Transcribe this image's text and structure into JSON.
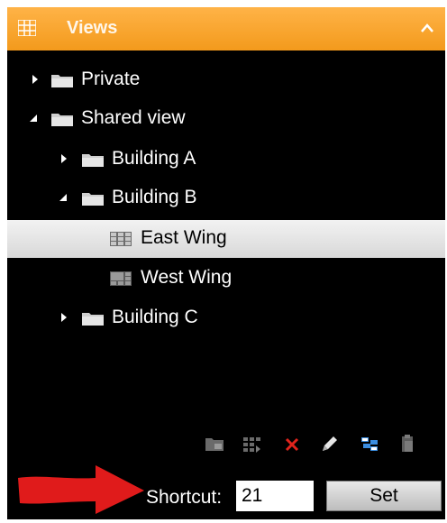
{
  "header": {
    "title": "Views",
    "icon": "grid-icon",
    "collapse_icon": "chevron-up-icon",
    "color": "#f5a623"
  },
  "tree": {
    "items": [
      {
        "label": "Private",
        "level": 0,
        "expanded": false,
        "icon": "folder-icon"
      },
      {
        "label": "Shared view",
        "level": 0,
        "expanded": true,
        "icon": "folder-icon"
      },
      {
        "label": "Building A",
        "level": 1,
        "expanded": false,
        "icon": "folder-icon"
      },
      {
        "label": "Building B",
        "level": 1,
        "expanded": true,
        "icon": "folder-icon"
      },
      {
        "label": "East Wing",
        "level": 2,
        "selected": true,
        "icon": "view-layout-icon"
      },
      {
        "label": "West Wing",
        "level": 2,
        "selected": false,
        "icon": "view-layout-icon"
      },
      {
        "label": "Building C",
        "level": 1,
        "expanded": false,
        "icon": "folder-icon"
      }
    ]
  },
  "toolbar": {
    "buttons": [
      "new-group-icon",
      "new-view-icon",
      "delete-icon",
      "rename-icon",
      "copy-view-icon",
      "paste-icon"
    ]
  },
  "footer": {
    "shortcut_label": "Shortcut:",
    "shortcut_value": "21",
    "set_label": "Set"
  }
}
